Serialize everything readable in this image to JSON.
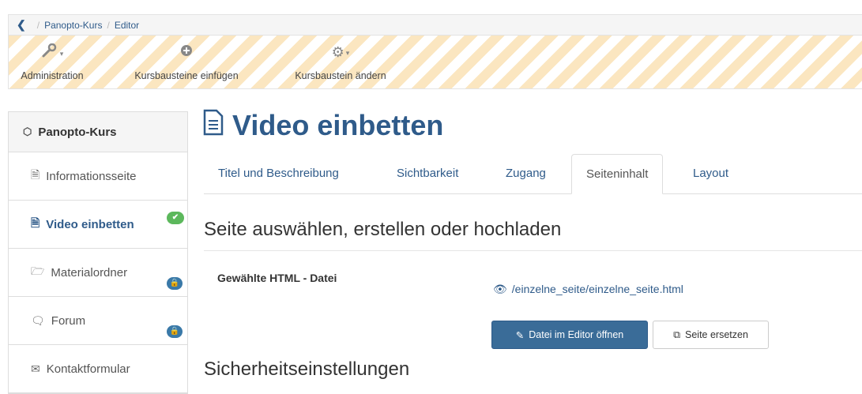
{
  "breadcrumb": {
    "back_icon": "chevron-left-icon",
    "items": [
      "Panopto-Kurs",
      "Editor"
    ]
  },
  "toolbar": {
    "admin": {
      "label": "Administration",
      "icon": "wrench-icon"
    },
    "insert": {
      "label": "Kursbausteine einfügen",
      "icon": "plus-circle-icon"
    },
    "change": {
      "label": "Kursbaustein ändern",
      "icon": "gear-icon"
    }
  },
  "sidebar": {
    "title": "Panopto-Kurs",
    "items": [
      {
        "label": "Informationsseite"
      },
      {
        "label": "Video einbetten",
        "active": true
      },
      {
        "label": "Materialordner"
      },
      {
        "label": "Forum"
      },
      {
        "label": "Kontaktformular"
      }
    ]
  },
  "main": {
    "title": "Video einbetten",
    "tabs": [
      "Titel und Beschreibung",
      "Sichtbarkeit",
      "Zugang",
      "Seiteninhalt",
      "Layout"
    ],
    "active_tab": "Seiteninhalt",
    "section1": "Seite auswählen, erstellen oder hochladen",
    "field_label": "Gewählte HTML - Datei",
    "file_path": "/einzelne_seite/einzelne_seite.html",
    "btn_open": "Datei im Editor öffnen",
    "btn_replace": "Seite ersetzen",
    "section2": "Sicherheitseinstellungen"
  },
  "colors": {
    "link": "#2f5b8a",
    "primary_button": "#3a6c98",
    "badge_green": "#5cb85c",
    "badge_blue": "#3a79a8",
    "stripe": "#fbe6c0"
  }
}
